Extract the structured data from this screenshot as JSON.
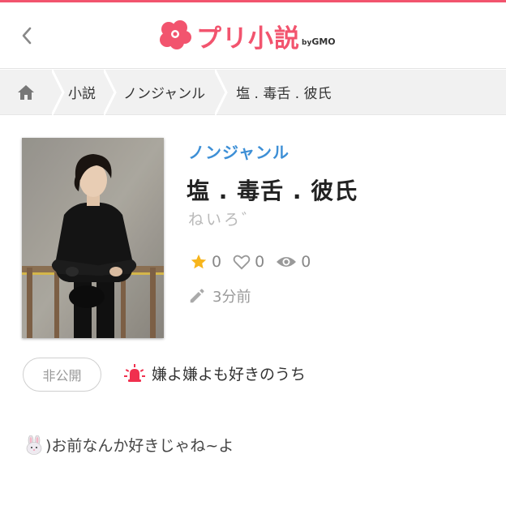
{
  "colors": {
    "brand": "#f2546e",
    "genre": "#3d8fd6",
    "star": "#f7b51c",
    "muted": "#999999"
  },
  "header": {
    "back_icon": "chevron-left-icon",
    "logo_text": "プリ小説",
    "logo_by": "by",
    "logo_company": "GMO"
  },
  "breadcrumb": {
    "home_icon": "home-icon",
    "items": [
      {
        "label": "小説"
      },
      {
        "label": "ノンジャンル"
      },
      {
        "label": "塩 . 毒舌 . 彼氏"
      }
    ]
  },
  "novel": {
    "genre": "ノンジャンル",
    "title": "塩 . 毒舌 . 彼氏",
    "author": "ねいろ゛",
    "stats": {
      "stars": "0",
      "likes": "0",
      "views": "0"
    },
    "updated": "3分前",
    "status_badge": "非公開",
    "series_title": "嫌よ嫌よも好きのうち",
    "description": ")お前なんか好きじゃね~よ"
  }
}
